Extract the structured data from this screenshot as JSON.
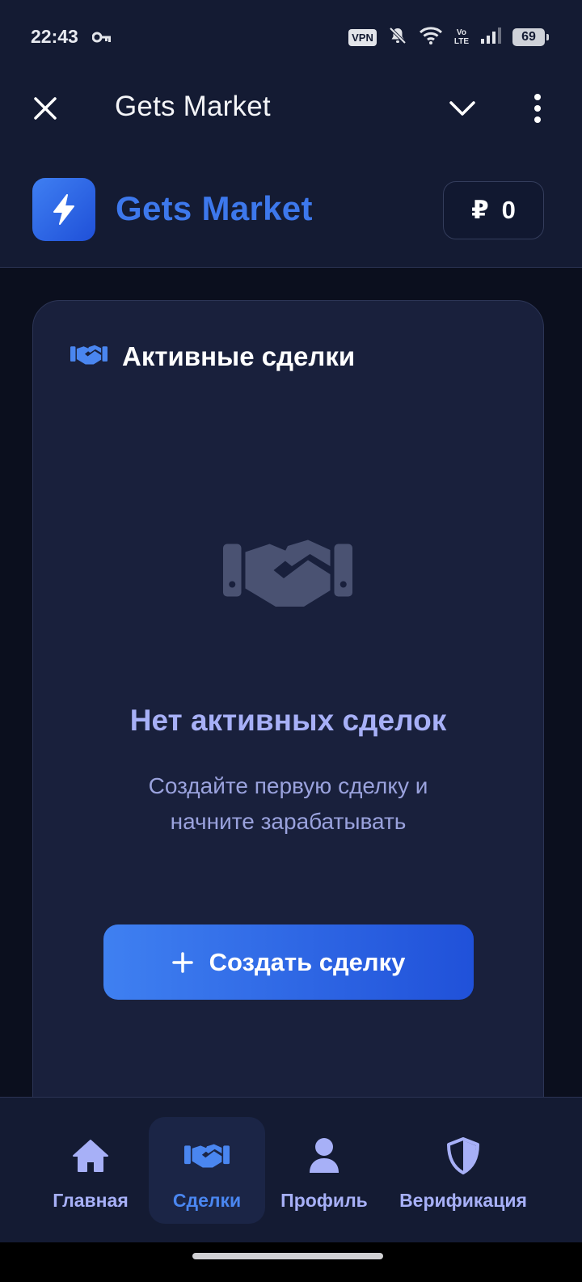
{
  "status_bar": {
    "time": "22:43",
    "vpn": "VPN",
    "volte_top": "Vo",
    "volte_bottom": "LTE",
    "battery": "69",
    "icons": [
      "key-icon",
      "bell-off-icon",
      "wifi-icon",
      "signal-icon",
      "battery-icon"
    ]
  },
  "header": {
    "title": "Gets Market",
    "icons": [
      "close-icon",
      "chevron-down-icon",
      "more-vertical-icon"
    ]
  },
  "brand": {
    "name": "Gets Market",
    "logo_icon": "lightning-icon",
    "balance_currency": "₽",
    "balance_value": "0"
  },
  "card": {
    "title": "Активные сделки",
    "title_icon": "handshake-icon",
    "empty_icon": "handshake-icon",
    "empty_title": "Нет активных сделок",
    "empty_subtitle_line1": "Создайте первую сделку и",
    "empty_subtitle_line2": "начните зарабатывать",
    "create_button_label": "Создать сделку",
    "create_button_icon": "plus-icon"
  },
  "bottom_nav": {
    "items": [
      {
        "label": "Главная",
        "icon": "home-icon",
        "active": false
      },
      {
        "label": "Сделки",
        "icon": "handshake-icon",
        "active": true
      },
      {
        "label": "Профиль",
        "icon": "user-icon",
        "active": false
      },
      {
        "label": "Верификация",
        "icon": "shield-icon",
        "active": false
      }
    ]
  },
  "colors": {
    "background": "#0b0f1e",
    "surface": "#141b33",
    "card": "#19203c",
    "accent": "#3d78ec",
    "muted_text": "#a7b0f7",
    "empty_icon": "#4a5272"
  }
}
